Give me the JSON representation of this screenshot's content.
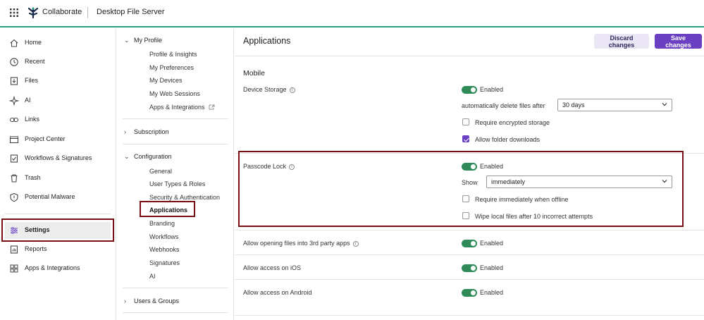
{
  "topbar": {
    "brand": "Collaborate",
    "server": "Desktop File Server",
    "brand_color": "#1a2b4a"
  },
  "leftnav": {
    "items": [
      {
        "label": "Home",
        "icon": "home-icon"
      },
      {
        "label": "Recent",
        "icon": "clock-icon"
      },
      {
        "label": "Files",
        "icon": "files-icon"
      },
      {
        "label": "AI",
        "icon": "sparkle-icon"
      },
      {
        "label": "Links",
        "icon": "link-icon"
      },
      {
        "label": "Project Center",
        "icon": "project-icon"
      },
      {
        "label": "Workflows & Signatures",
        "icon": "workflow-icon"
      },
      {
        "label": "Trash",
        "icon": "trash-icon"
      },
      {
        "label": "Potential Malware",
        "icon": "shield-icon"
      },
      {
        "label": "Settings",
        "icon": "sliders-icon"
      },
      {
        "label": "Reports",
        "icon": "reports-icon"
      },
      {
        "label": "Apps & Integrations",
        "icon": "apps-icon"
      }
    ],
    "active": "Settings"
  },
  "midnav": {
    "profile": {
      "label": "My Profile",
      "items": [
        "Profile & Insights",
        "My Preferences",
        "My Devices",
        "My Web Sessions",
        "Apps & Integrations"
      ]
    },
    "subscription": "Subscription",
    "configuration": {
      "label": "Configuration",
      "items": [
        "General",
        "User Types & Roles",
        "Security & Authentication",
        "Applications",
        "Branding",
        "Workflows",
        "Webhooks",
        "Signatures",
        "AI"
      ]
    },
    "users_groups": "Users & Groups",
    "active": "Applications"
  },
  "main": {
    "title": "Applications",
    "discard_label": "Discard changes",
    "save_label": "Save changes",
    "subtitle": "Mobile",
    "enabled_label": "Enabled",
    "device_storage": {
      "label": "Device Storage",
      "enabled": true,
      "auto_delete_label": "automatically delete files after",
      "auto_delete_value": "30 days",
      "require_encrypted_label": "Require encrypted storage",
      "require_encrypted": false,
      "allow_folder_downloads_label": "Allow folder downloads",
      "allow_folder_downloads": true
    },
    "passcode_lock": {
      "label": "Passcode Lock",
      "enabled": true,
      "show_label": "Show",
      "show_value": "immediately",
      "require_offline_label": "Require immediately when offline",
      "require_offline": false,
      "wipe_label": "Wipe local files after 10 incorrect attempts",
      "wipe": false
    },
    "third_party": {
      "label": "Allow opening files into 3rd party apps",
      "enabled": true
    },
    "ios": {
      "label": "Allow access on iOS",
      "enabled": true
    },
    "android": {
      "label": "Allow access on Android",
      "enabled": true
    }
  },
  "colors": {
    "accent": "#6a3fc2",
    "toggle_on": "#2e8b57",
    "highlight_box": "#7a0e14",
    "topbar_border": "#2aa08a"
  }
}
